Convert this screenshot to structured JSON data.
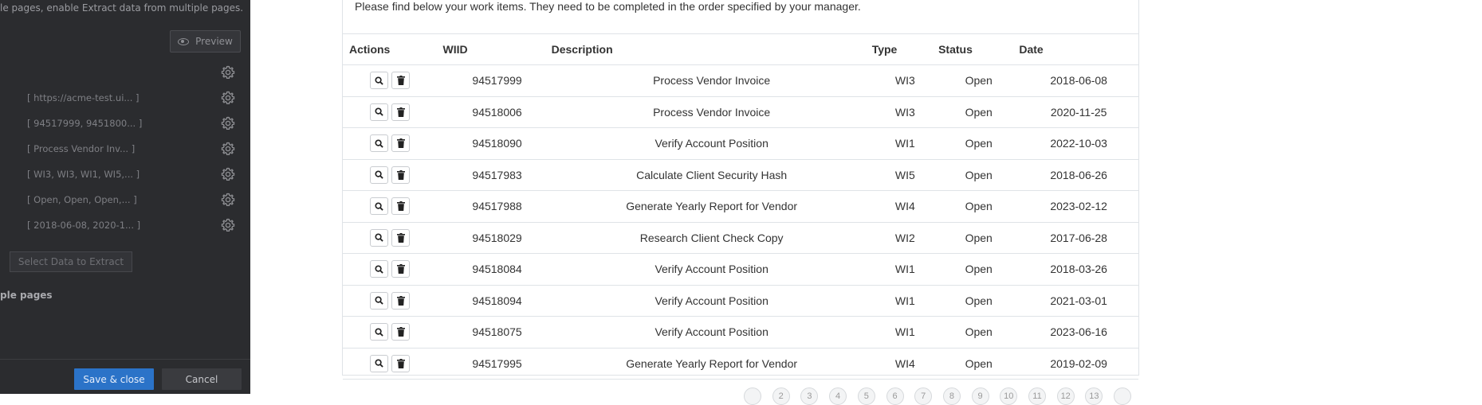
{
  "panel": {
    "note": "le pages, enable Extract data from multiple pages.",
    "preview_label": "Preview",
    "fields": [
      {
        "value": ""
      },
      {
        "value": "[ https://acme-test.ui... ]"
      },
      {
        "value": "[ 94517999, 9451800... ]"
      },
      {
        "value": "[ Process Vendor Inv... ]"
      },
      {
        "value": "[ WI3, WI3, WI1, WI5,... ]"
      },
      {
        "value": "[ Open, Open, Open,... ]"
      },
      {
        "value": "[ 2018-06-08, 2020-1... ]"
      }
    ],
    "select_data_label": "Select Data to Extract",
    "multi_pages_label": "ple pages",
    "save_label": "Save & close",
    "cancel_label": "Cancel"
  },
  "main": {
    "intro": "Please find below your work items. They need to be completed in the order specified by your manager.",
    "columns": {
      "actions": "Actions",
      "wiid": "WIID",
      "description": "Description",
      "type": "Type",
      "status": "Status",
      "date": "Date"
    },
    "rows": [
      {
        "wiid": "94517999",
        "description": "Process Vendor Invoice",
        "type": "WI3",
        "status": "Open",
        "date": "2018-06-08"
      },
      {
        "wiid": "94518006",
        "description": "Process Vendor Invoice",
        "type": "WI3",
        "status": "Open",
        "date": "2020-11-25"
      },
      {
        "wiid": "94518090",
        "description": "Verify Account Position",
        "type": "WI1",
        "status": "Open",
        "date": "2022-10-03"
      },
      {
        "wiid": "94517983",
        "description": "Calculate Client Security Hash",
        "type": "WI5",
        "status": "Open",
        "date": "2018-06-26"
      },
      {
        "wiid": "94517988",
        "description": "Generate Yearly Report for Vendor",
        "type": "WI4",
        "status": "Open",
        "date": "2023-02-12"
      },
      {
        "wiid": "94518029",
        "description": "Research Client Check Copy",
        "type": "WI2",
        "status": "Open",
        "date": "2017-06-28"
      },
      {
        "wiid": "94518084",
        "description": "Verify Account Position",
        "type": "WI1",
        "status": "Open",
        "date": "2018-03-26"
      },
      {
        "wiid": "94518094",
        "description": "Verify Account Position",
        "type": "WI1",
        "status": "Open",
        "date": "2021-03-01"
      },
      {
        "wiid": "94518075",
        "description": "Verify Account Position",
        "type": "WI1",
        "status": "Open",
        "date": "2023-06-16"
      },
      {
        "wiid": "94517995",
        "description": "Generate Yearly Report for Vendor",
        "type": "WI4",
        "status": "Open",
        "date": "2019-02-09"
      }
    ],
    "pages": [
      "",
      "2",
      "3",
      "4",
      "5",
      "6",
      "7",
      "8",
      "9",
      "10",
      "11",
      "12",
      "13",
      ""
    ]
  },
  "icons": {
    "view": "search-icon",
    "delete": "trash-icon",
    "settings": "gear-icon",
    "preview": "eye-icon"
  },
  "colors": {
    "panel_bg": "#2b2c2f",
    "save_button": "#2b73c8",
    "table_border": "#dfe3e7"
  }
}
